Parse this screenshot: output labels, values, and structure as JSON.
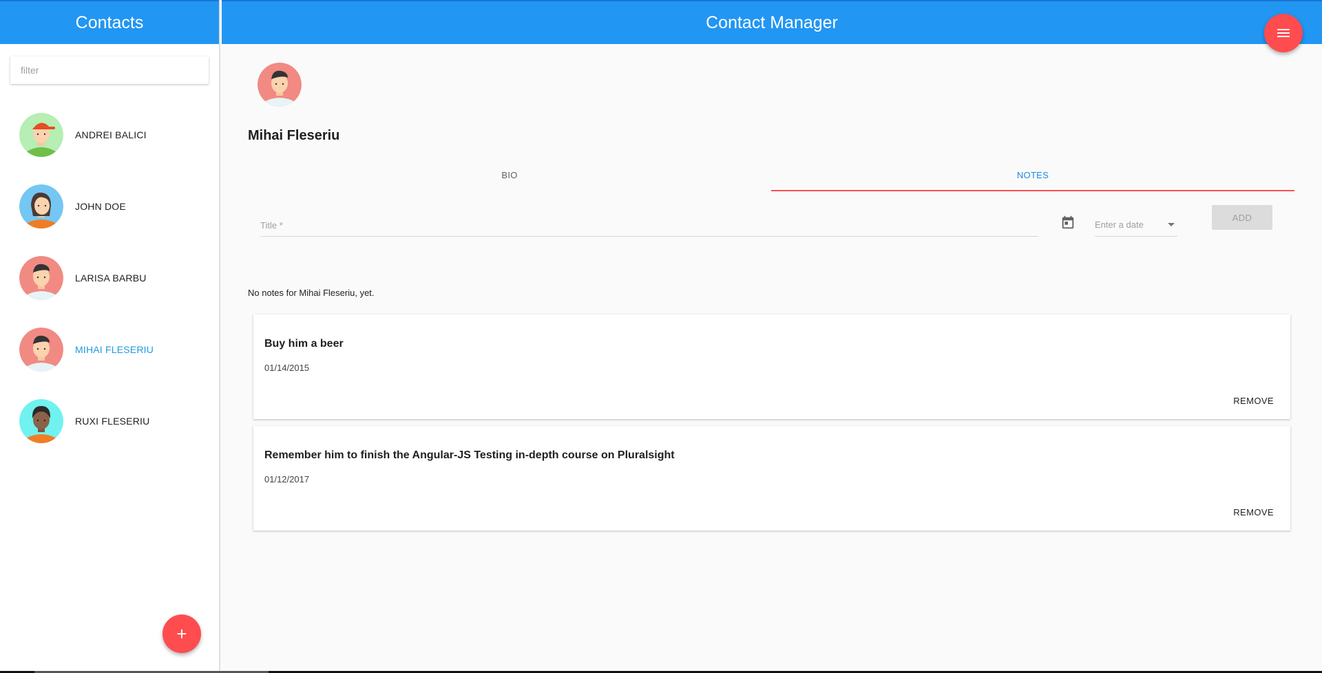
{
  "sidebar": {
    "title": "Contacts",
    "filter_placeholder": "filter",
    "contacts": [
      {
        "name": "ANDREI BALICI",
        "avatar": "boy-cap-avatar-icon"
      },
      {
        "name": "JOHN DOE",
        "avatar": "girl-avatar-icon"
      },
      {
        "name": "LARISA BARBU",
        "avatar": "boy-avatar-icon"
      },
      {
        "name": "MIHAI FLESERIU",
        "avatar": "boy-avatar-icon"
      },
      {
        "name": "RUXI FLESERIU",
        "avatar": "dark-avatar-icon"
      }
    ],
    "add_label": "+"
  },
  "header": {
    "title": "Contact Manager"
  },
  "detail": {
    "name": "Mihai Fleseriu",
    "tabs": [
      {
        "label": "BIO"
      },
      {
        "label": "NOTES"
      }
    ],
    "form": {
      "title_placeholder": "Title *",
      "date_placeholder": "Enter a date",
      "add_label": "ADD"
    },
    "empty_message": "No notes for Mihai Fleseriu, yet.",
    "notes": [
      {
        "title": "Buy him a beer",
        "date": "01/14/2015",
        "remove_label": "REMOVE"
      },
      {
        "title": "Remember him to finish the Angular-JS Testing in-depth course on Pluralsight",
        "date": "01/12/2017",
        "remove_label": "REMOVE"
      }
    ]
  },
  "colors": {
    "primary": "#2196f3",
    "accent": "#ff4c4f",
    "active_text": "#1e9ae0"
  }
}
